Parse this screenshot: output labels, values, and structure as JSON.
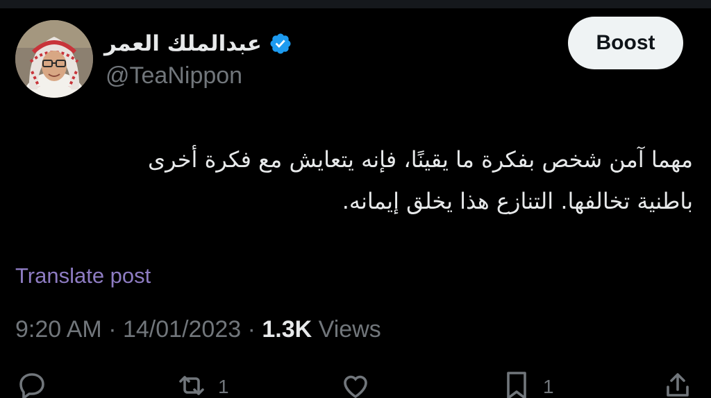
{
  "author": {
    "display_name": "عبدالملك العمر",
    "handle": "@TeaNippon",
    "verified_icon": "verified-badge-icon",
    "verified_color": "#1d9bf0"
  },
  "header": {
    "boost_label": "Boost"
  },
  "post": {
    "lines": [
      "مهما آمن شخص بفكرة ما يقينًا، فإنه يتعايش مع فكرة أخرى",
      "باطنية تخالفها. التنازع هذا يخلق إيمانه."
    ],
    "translate_label": "Translate post",
    "time": "9:20 AM",
    "separator": "·",
    "date": "14/01/2023",
    "views_count": "1.3K",
    "views_label": "Views"
  },
  "actions": {
    "reply": {
      "icon": "reply-icon",
      "count": ""
    },
    "repost": {
      "icon": "repost-icon",
      "count": "1"
    },
    "like": {
      "icon": "heart-icon",
      "count": ""
    },
    "bookmark": {
      "icon": "bookmark-icon",
      "count": "1"
    },
    "share": {
      "icon": "share-icon",
      "count": ""
    }
  },
  "colors": {
    "background": "#000000",
    "text": "#e7e9ea",
    "secondary_text": "#71767b",
    "translate_link": "#8e7cc3",
    "boost_bg": "#eff3f4"
  }
}
